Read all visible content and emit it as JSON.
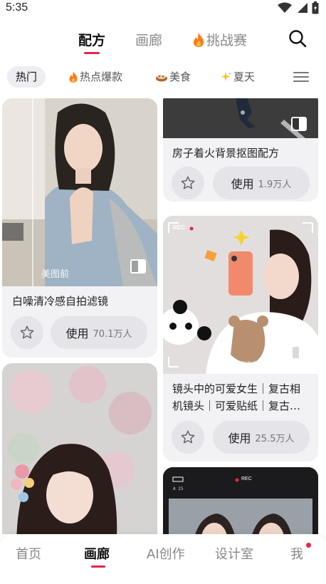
{
  "status_bar": {
    "time": "5:35",
    "icons": [
      "wifi-icon",
      "signal-icon",
      "battery-icon"
    ]
  },
  "top_tabs": [
    {
      "label": "配方",
      "active": true
    },
    {
      "label": "画廊",
      "active": false
    },
    {
      "label": "挑战赛",
      "active": false,
      "icon": "fire-icon"
    }
  ],
  "chips": [
    {
      "label": "热门",
      "active": true
    },
    {
      "label": "热点爆款",
      "icon": "fire-icon"
    },
    {
      "label": "美食",
      "icon": "food-icon"
    },
    {
      "label": "夏天",
      "icon": "sparkle-icon"
    }
  ],
  "cards": [
    {
      "title": "白噪清冷感自拍滤镜",
      "use_label": "使用",
      "use_count": "70.1万人",
      "overlay_text": "美图前"
    },
    {
      "title": "房子着火背景抠图配方",
      "use_label": "使用",
      "use_count": "1.9万人"
    },
    {
      "title_line1": "镜头中的可爱女生｜复古相",
      "title_line2": "机镜头｜可爱贴纸｜复古…",
      "use_label": "使用",
      "use_count": "25.5万人",
      "rec_label": "REC",
      "caption": "Welcome to old new world"
    },
    {
      "title": "",
      "rec_label": "REC"
    }
  ],
  "bottom_nav": [
    {
      "label": "首页",
      "active": false
    },
    {
      "label": "画廊",
      "active": true
    },
    {
      "label": "AI创作",
      "active": false
    },
    {
      "label": "设计室",
      "active": false
    },
    {
      "label": "我",
      "active": false,
      "badge": true
    }
  ],
  "colors": {
    "accent": "#e5254a",
    "card_bg": "#f2f2f5",
    "button_bg": "#e4e4e9"
  }
}
